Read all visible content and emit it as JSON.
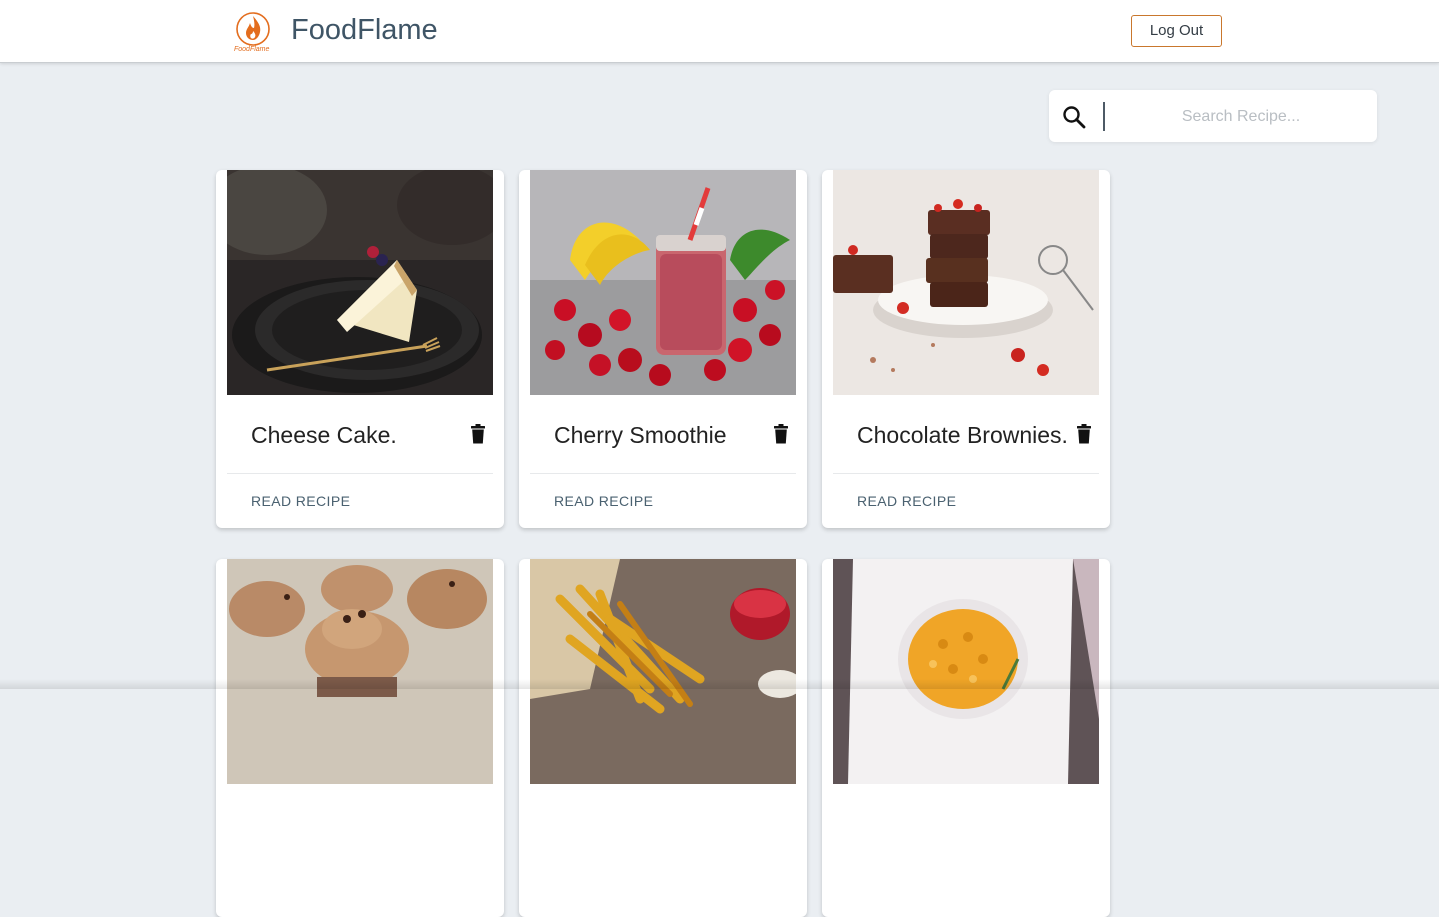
{
  "app": {
    "brand": "FoodFlame",
    "logo_text": "FoodFlame",
    "logout_label": "Log Out",
    "accent_color": "#e36d1e"
  },
  "search": {
    "placeholder": "Search Recipe...",
    "value": ""
  },
  "recipes": [
    {
      "title": "Cheese Cake.",
      "action": "READ RECIPE",
      "image": "cheesecake-slice"
    },
    {
      "title": "Cherry Smoothie",
      "action": "READ RECIPE",
      "image": "cherry-smoothie-jar"
    },
    {
      "title": "Chocolate Brownies.",
      "action": "READ RECIPE",
      "image": "brownie-stack"
    },
    {
      "title": "",
      "action": "",
      "image": "chocolate-cupcakes"
    },
    {
      "title": "",
      "action": "",
      "image": "french-fries"
    },
    {
      "title": "",
      "action": "",
      "image": "mac-and-cheese"
    }
  ]
}
